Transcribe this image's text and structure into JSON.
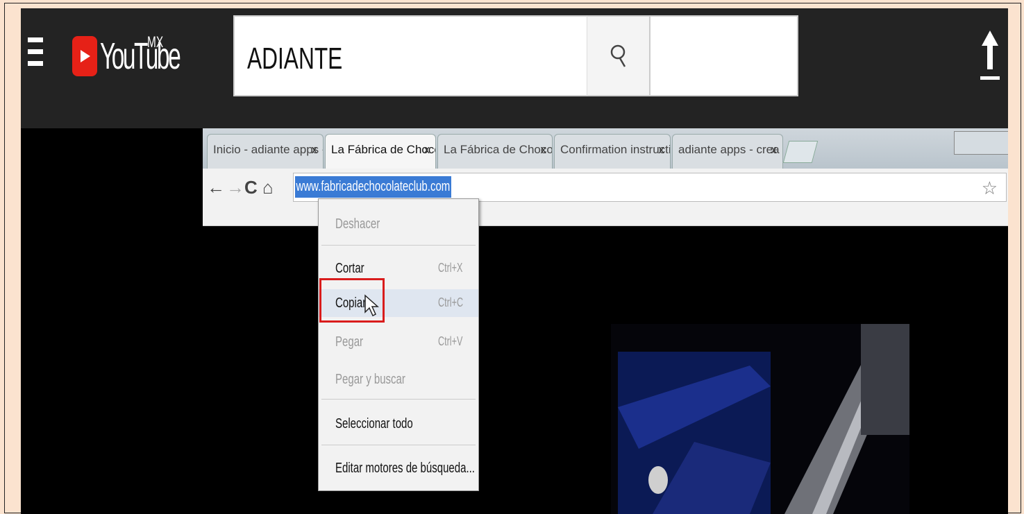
{
  "youtube": {
    "logo_text": "YouTube",
    "region": "MX",
    "search_value": "ADIANTE"
  },
  "browser": {
    "tabs": [
      {
        "label": "Inicio - adiante apps - cre",
        "close": "x",
        "active": false
      },
      {
        "label": "La Fábrica de Chocolate C",
        "close": "x",
        "active": true
      },
      {
        "label": "La Fábrica de Chocolate C",
        "close": "x",
        "active": false
      },
      {
        "label": "Confirmation instruction",
        "close": "x",
        "active": false
      },
      {
        "label": "adiante apps - crea tu ap",
        "close": "x",
        "active": false
      }
    ],
    "url": "www.fabricadechocolateclub.com"
  },
  "context_menu": {
    "items": [
      {
        "label": "Deshacer",
        "shortcut": "",
        "disabled": true
      },
      {
        "label": "Cortar",
        "shortcut": "Ctrl+X",
        "disabled": false
      },
      {
        "label": "Copiar",
        "shortcut": "Ctrl+C",
        "disabled": false
      },
      {
        "label": "Pegar",
        "shortcut": "Ctrl+V",
        "disabled": true
      },
      {
        "label": "Pegar y buscar",
        "shortcut": "",
        "disabled": true
      },
      {
        "label": "Seleccionar todo",
        "shortcut": "",
        "disabled": false
      },
      {
        "label": "Editar motores de búsqueda...",
        "shortcut": "",
        "disabled": false
      }
    ],
    "highlighted": "Copiar"
  },
  "colors": {
    "border_bg": "#fbe3cf",
    "yt_header": "#232323",
    "yt_red": "#e62117",
    "highlight": "#d91c1c",
    "selection": "#3a7bd5"
  }
}
